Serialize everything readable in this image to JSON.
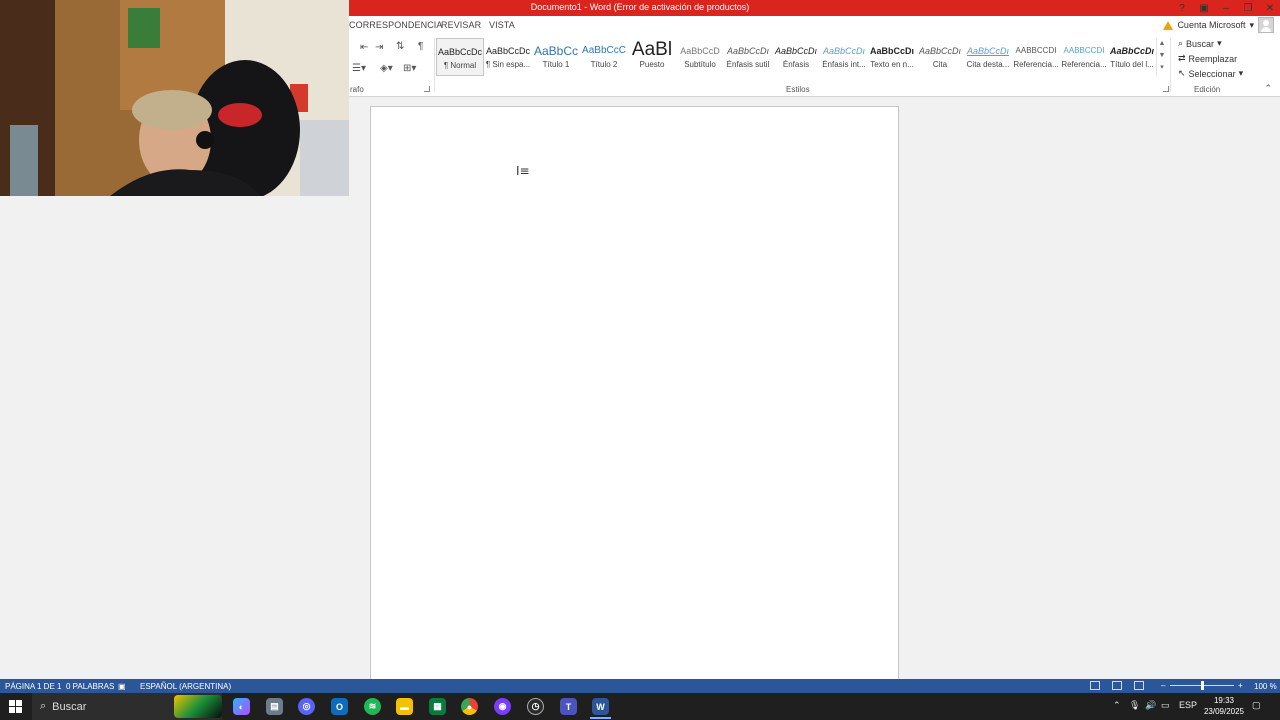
{
  "window": {
    "title": "Documento1 - Word (Error de activación de productos)",
    "controls": [
      "?",
      "▣",
      "–",
      "❐",
      "✕"
    ]
  },
  "tabs": [
    "CORRESPONDENCIA",
    "REVISAR",
    "VISTA"
  ],
  "account": {
    "label": "Cuenta Microsoft",
    "icon": "warning-icon"
  },
  "paragraph_group": {
    "label": "rafo",
    "pilcrow": "¶"
  },
  "styles": {
    "group_label": "Estilos",
    "items": [
      {
        "sample": "AaBbCcDc",
        "name": "¶ Normal"
      },
      {
        "sample": "AaBbCcDc",
        "name": "¶ Sin espa..."
      },
      {
        "sample": "AaBbCc",
        "name": "Título 1"
      },
      {
        "sample": "AaBbCcC",
        "name": "Título 2"
      },
      {
        "sample": "AaBl",
        "name": "Puesto"
      },
      {
        "sample": "AaBbCcD",
        "name": "Subtítulo"
      },
      {
        "sample": "AaBbCcDı",
        "name": "Énfasis sutil"
      },
      {
        "sample": "AaBbCcDı",
        "name": "Énfasis"
      },
      {
        "sample": "AaBbCcDı",
        "name": "Énfasis int..."
      },
      {
        "sample": "AaBbCcDı",
        "name": "Texto en n..."
      },
      {
        "sample": "AaBbCcDı",
        "name": "Cita"
      },
      {
        "sample": "AaBbCcDı",
        "name": "Cita desta..."
      },
      {
        "sample": "AABBCCDI",
        "name": "Referencia..."
      },
      {
        "sample": "AABBCCDI",
        "name": "Referencia..."
      },
      {
        "sample": "AaBbCcDı",
        "name": "Título del l..."
      }
    ]
  },
  "editing": {
    "group_label": "Edición",
    "buscar": "Buscar",
    "reemplazar": "Reemplazar",
    "seleccionar": "Seleccionar"
  },
  "status": {
    "page": "PÁGINA 1 DE 1",
    "words": "0 PALABRAS",
    "language": "ESPAÑOL (ARGENTINA)",
    "zoom": "100 %",
    "zoom_minus": "–",
    "zoom_plus": "+"
  },
  "taskbar": {
    "search_placeholder": "Buscar",
    "lang": "ESP",
    "time": "19:33",
    "date": "23/09/2025"
  }
}
